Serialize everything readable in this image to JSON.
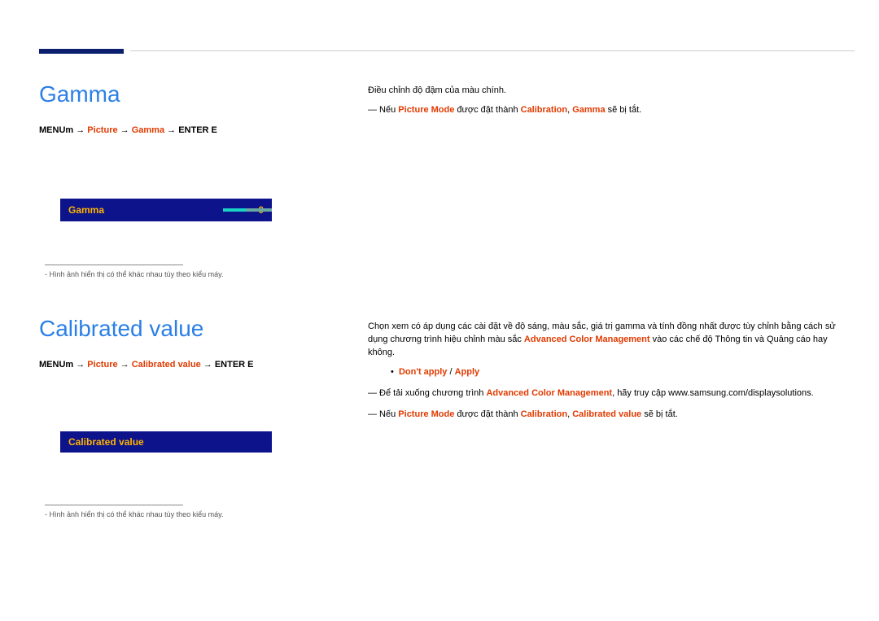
{
  "header": {},
  "gamma": {
    "title": "Gamma",
    "breadcrumb": {
      "p1": "MENU",
      "p2": "m",
      "sep": " → ",
      "p3": "Picture",
      "p4": "Gamma",
      "tail": " → ENTER E"
    },
    "ui": {
      "label": "Gamma",
      "value": "0"
    },
    "footnote_pre": "-",
    "footnote": " Hình ảnh hiển thị có thể khác nhau tùy theo kiểu máy.",
    "right": {
      "line1": "Điều chỉnh độ đậm của màu chính.",
      "note_lead": "― Nếu ",
      "note_kw1": "Picture Mode",
      "note_mid": " được đặt thành ",
      "note_kw2": "Calibration",
      "note_comma": ", ",
      "note_kw3": "Gamma",
      "note_tail": " sẽ bị tắt."
    }
  },
  "calib": {
    "title": "Calibrated value",
    "breadcrumb": {
      "p1": "MENU",
      "p2": "m",
      "sep": " → ",
      "p3": "Picture",
      "p4": "Calibrated value",
      "tail": " → ENTER E"
    },
    "ui": {
      "label": "Calibrated value"
    },
    "footnote_pre": "-",
    "footnote": " Hình ảnh hiển thị có thể khác nhau tùy theo kiểu máy.",
    "right": {
      "line1_a": "Chọn xem có áp dụng các cài đặt về độ sáng, màu sắc, giá trị gamma và tính đồng nhất được tùy chỉnh bằng cách sử dụng chương trình hiệu chỉnh màu sắc ",
      "line1_kw": "Advanced Color Management",
      "line1_b": " vào các chế độ Thông tin và Quảng cáo hay không.",
      "bullet_a": "Don't apply",
      "bullet_sep": " / ",
      "bullet_b": "Apply",
      "dl_a": "― Để tải xuống chương trình ",
      "dl_kw": "Advanced Color Management",
      "dl_b": ", hãy truy cập www.samsung.com/displaysolutions.",
      "note_lead": "― Nếu ",
      "note_kw1": "Picture Mode",
      "note_mid": " được đặt thành ",
      "note_kw2": "Calibration",
      "note_comma": ", ",
      "note_kw3": "Calibrated value",
      "note_tail": " sẽ bị tắt."
    }
  }
}
